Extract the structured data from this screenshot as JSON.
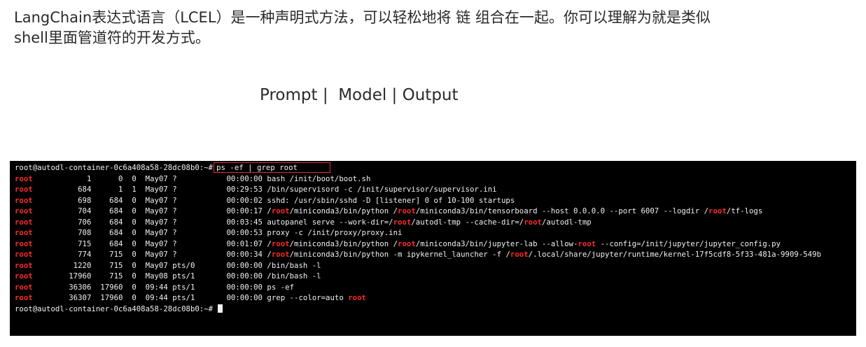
{
  "intro": {
    "text": "LangChain表达式语言（LCEL）是一种声明式方法，可以轻松地将 链 组合在一起。你可以理解为就是类似shell里面管道符的开发方式。"
  },
  "pipeline": {
    "text": "Prompt |  Model | Output"
  },
  "terminal": {
    "prompt": "root@autodl-container-0c6a408a58-28dc08b0:~#",
    "command": "ps -ef | grep root",
    "rows": [
      {
        "user": "root",
        "pid": "1",
        "ppid": "0",
        "c": "0",
        "stime": "May07",
        "tty": "?",
        "time": "00:00:00",
        "cmd": [
          {
            "t": "bash /init/boot/boot.sh"
          }
        ]
      },
      {
        "user": "root",
        "pid": "684",
        "ppid": "1",
        "c": "1",
        "stime": "May07",
        "tty": "?",
        "time": "00:29:53",
        "cmd": [
          {
            "t": "/bin/supervisord -c /init/supervisor/supervisor.ini"
          }
        ]
      },
      {
        "user": "root",
        "pid": "698",
        "ppid": "684",
        "c": "0",
        "stime": "May07",
        "tty": "?",
        "time": "00:00:02",
        "cmd": [
          {
            "t": "sshd: /usr/sbin/sshd -D [listener] 0 of 10-100 startups"
          }
        ]
      },
      {
        "user": "root",
        "pid": "704",
        "ppid": "684",
        "c": "0",
        "stime": "May07",
        "tty": "?",
        "time": "00:00:17",
        "cmd": [
          {
            "t": "/"
          },
          {
            "t": "root",
            "h": true
          },
          {
            "t": "/miniconda3/bin/python /"
          },
          {
            "t": "root",
            "h": true
          },
          {
            "t": "/miniconda3/bin/tensorboard --host 0.0.0.0 --port 6007 --logdir /"
          },
          {
            "t": "root",
            "h": true
          },
          {
            "t": "/tf-logs"
          }
        ]
      },
      {
        "user": "root",
        "pid": "706",
        "ppid": "684",
        "c": "0",
        "stime": "May07",
        "tty": "?",
        "time": "00:03:45",
        "cmd": [
          {
            "t": "autopanel serve --work-dir=/"
          },
          {
            "t": "root",
            "h": true
          },
          {
            "t": "/autodl-tmp --cache-dir=/"
          },
          {
            "t": "root",
            "h": true
          },
          {
            "t": "/autodl-tmp"
          }
        ]
      },
      {
        "user": "root",
        "pid": "708",
        "ppid": "684",
        "c": "0",
        "stime": "May07",
        "tty": "?",
        "time": "00:00:53",
        "cmd": [
          {
            "t": "proxy -c /init/proxy/proxy.ini"
          }
        ]
      },
      {
        "user": "root",
        "pid": "715",
        "ppid": "684",
        "c": "0",
        "stime": "May07",
        "tty": "?",
        "time": "00:01:07",
        "cmd": [
          {
            "t": "/"
          },
          {
            "t": "root",
            "h": true
          },
          {
            "t": "/miniconda3/bin/python /"
          },
          {
            "t": "root",
            "h": true
          },
          {
            "t": "/miniconda3/bin/jupyter-lab --allow-"
          },
          {
            "t": "root",
            "h": true
          },
          {
            "t": " --config=/init/jupyter/jupyter_config.py"
          }
        ]
      },
      {
        "user": "root",
        "pid": "774",
        "ppid": "715",
        "c": "0",
        "stime": "May07",
        "tty": "?",
        "time": "00:00:34",
        "cmd": [
          {
            "t": "/"
          },
          {
            "t": "root",
            "h": true
          },
          {
            "t": "/miniconda3/bin/python -m ipykernel_launcher -f /"
          },
          {
            "t": "root",
            "h": true
          },
          {
            "t": "/.local/share/jupyter/runtime/kernel-17f5cdf8-5f33-481a-9909-549b"
          }
        ]
      },
      {
        "user": "root",
        "pid": "1220",
        "ppid": "715",
        "c": "0",
        "stime": "May07",
        "tty": "pts/0",
        "time": "00:00:00",
        "cmd": [
          {
            "t": "/bin/bash -l"
          }
        ]
      },
      {
        "user": "root",
        "pid": "17960",
        "ppid": "715",
        "c": "0",
        "stime": "May08",
        "tty": "pts/1",
        "time": "00:00:00",
        "cmd": [
          {
            "t": "/bin/bash -l"
          }
        ]
      },
      {
        "user": "root",
        "pid": "36306",
        "ppid": "17960",
        "c": "0",
        "stime": "09:44",
        "tty": "pts/1",
        "time": "00:00:00",
        "cmd": [
          {
            "t": "ps -ef"
          }
        ]
      },
      {
        "user": "root",
        "pid": "36307",
        "ppid": "17960",
        "c": "0",
        "stime": "09:44",
        "tty": "pts/1",
        "time": "00:00:00",
        "cmd": [
          {
            "t": "grep --color=auto "
          },
          {
            "t": "root",
            "h": true
          }
        ]
      }
    ]
  },
  "colors": {
    "highlight": "#ff2a2a",
    "terminal_bg": "#000000",
    "terminal_fg": "#f0f0f0",
    "command_box_border": "#e23030"
  }
}
